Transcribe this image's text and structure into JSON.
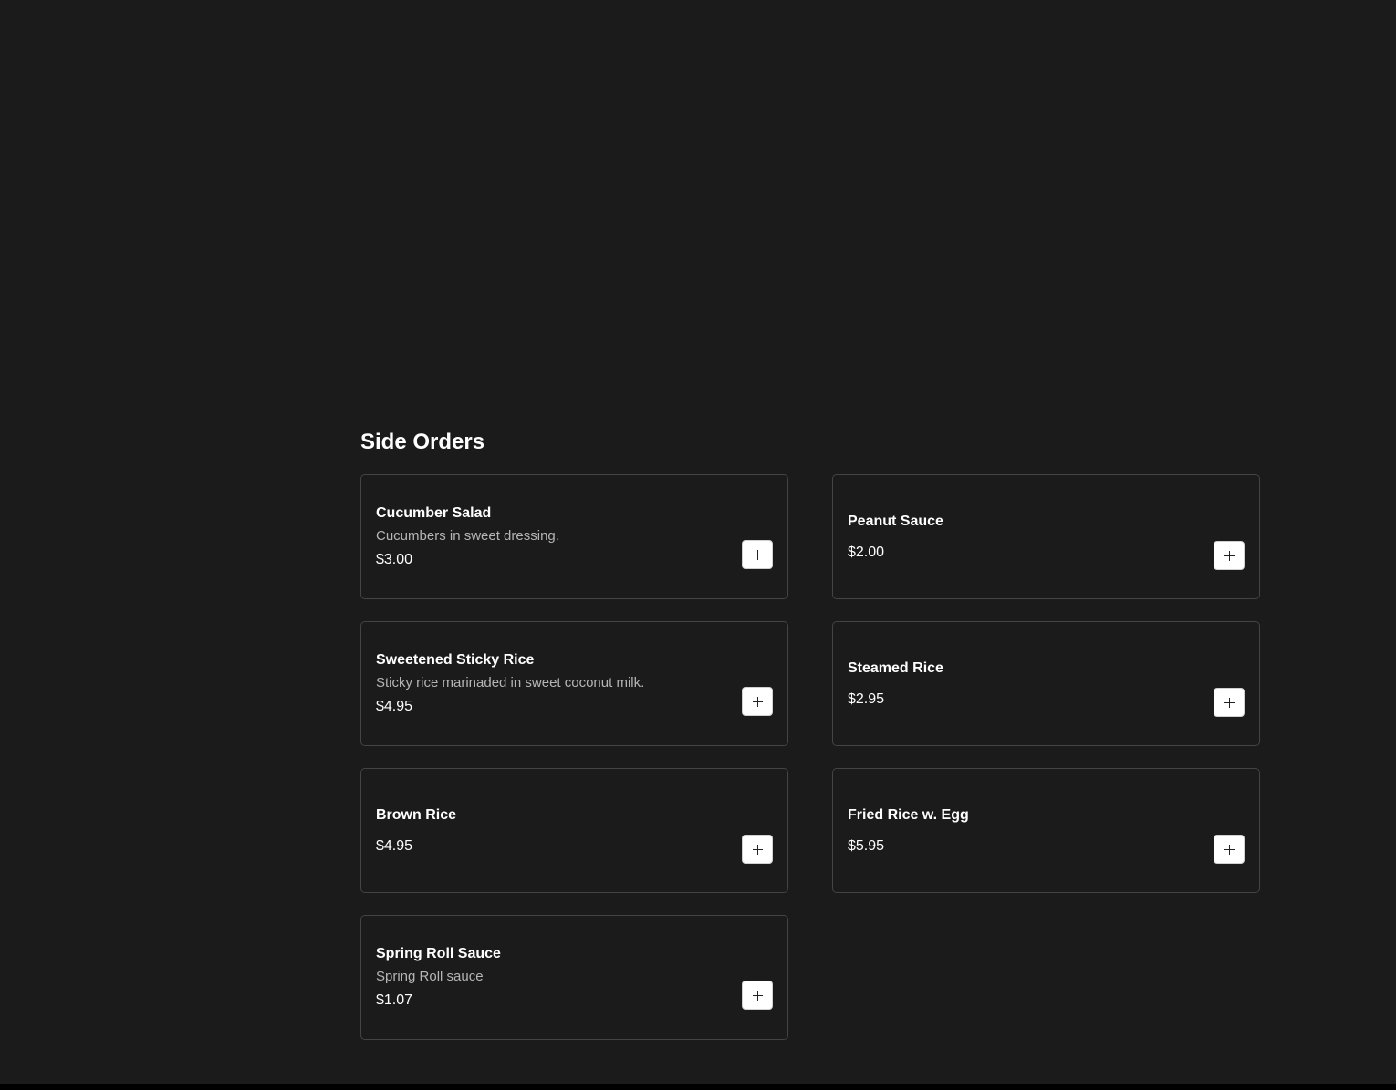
{
  "section": {
    "title": "Side Orders"
  },
  "items": [
    {
      "name": "Cucumber Salad",
      "description": "Cucumbers in sweet dressing.",
      "price": "$3.00",
      "add_icon": "plus-icon"
    },
    {
      "name": "Peanut Sauce",
      "description": "",
      "price": "$2.00",
      "add_icon": "plus-icon"
    },
    {
      "name": "Sweetened Sticky Rice",
      "description": "Sticky rice marinaded in sweet coconut milk.",
      "price": "$4.95",
      "add_icon": "plus-icon"
    },
    {
      "name": "Steamed Rice",
      "description": "",
      "price": "$2.95",
      "add_icon": "plus-icon"
    },
    {
      "name": "Brown Rice",
      "description": "",
      "price": "$4.95",
      "add_icon": "plus-icon"
    },
    {
      "name": "Fried Rice w. Egg",
      "description": "",
      "price": "$5.95",
      "add_icon": "plus-icon"
    },
    {
      "name": "Spring Roll Sauce",
      "description": "Spring Roll sauce",
      "price": "$1.07",
      "add_icon": "plus-icon"
    }
  ],
  "colors": {
    "background": "#1b1b1b",
    "card_border": "#444444",
    "text_primary": "#ffffff",
    "text_secondary": "#b5b5b5",
    "button_background": "#ffffff"
  }
}
